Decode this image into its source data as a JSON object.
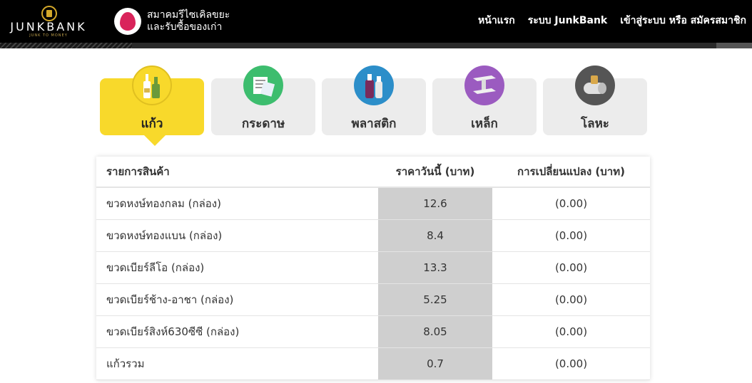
{
  "header": {
    "logo_text": "JUNKBANK",
    "logo_tagline": "JUNK TO MONEY",
    "association_line1": "สมาคมรีไซเคิลขยะ",
    "association_line2": "และรับซื้อของเก่า",
    "nav": [
      "หน้าแรก",
      "ระบบ JunkBank",
      "เข้าสู่ระบบ หรือ สมัครสมาชิก"
    ]
  },
  "categories": [
    {
      "label": "แก้ว",
      "icon": "glass-bottles-icon",
      "color": "#f8d92b",
      "active": true
    },
    {
      "label": "กระดาษ",
      "icon": "paper-icon",
      "color": "#3dbd6e",
      "active": false
    },
    {
      "label": "พลาสติก",
      "icon": "plastic-bottle-icon",
      "color": "#2c8ec9",
      "active": false
    },
    {
      "label": "เหล็ก",
      "icon": "steel-beam-icon",
      "color": "#9b5bc0",
      "active": false
    },
    {
      "label": "โลหะ",
      "icon": "metal-can-icon",
      "color": "#555555",
      "active": false
    }
  ],
  "table": {
    "headers": [
      "รายการสินค้า",
      "ราคาวันนี้ (บาท)",
      "การเปลี่ยนแปลง (บาท)"
    ],
    "rows": [
      {
        "item": "ขวดหงษ์ทองกลม (กล่อง)",
        "price": "12.6",
        "change": "(0.00)"
      },
      {
        "item": "ขวดหงษ์ทองแบน (กล่อง)",
        "price": "8.4",
        "change": "(0.00)"
      },
      {
        "item": "ขวดเบียร์ลีโอ (กล่อง)",
        "price": "13.3",
        "change": "(0.00)"
      },
      {
        "item": "ขวดเบียร์ช้าง-อาชา (กล่อง)",
        "price": "5.25",
        "change": "(0.00)"
      },
      {
        "item": "ขวดเบียร์สิงห์630ซีซี (กล่อง)",
        "price": "8.05",
        "change": "(0.00)"
      },
      {
        "item": "แก้วรวม",
        "price": "0.7",
        "change": "(0.00)"
      }
    ]
  }
}
